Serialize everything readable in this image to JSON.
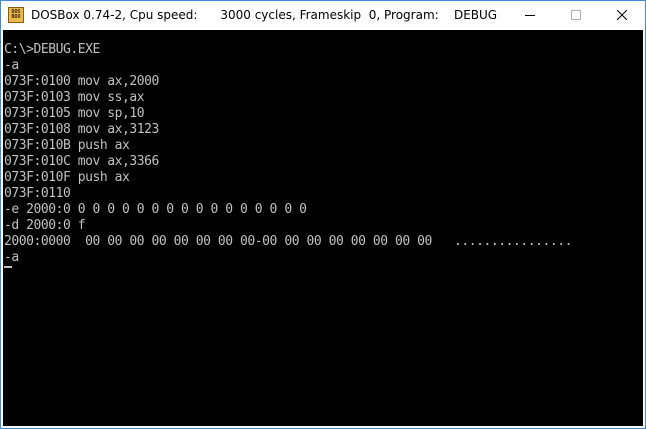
{
  "window": {
    "title": "DOSBox 0.74-2, Cpu speed:      3000 cycles, Frameskip  0, Program:    DEBUG",
    "icon": "dosbox-icon",
    "icon_text_top": "DOS",
    "icon_text_bottom": "BOX",
    "controls": [
      "minimize-icon",
      "maximize-icon",
      "close-icon"
    ]
  },
  "console": {
    "lines": [
      "C:\\>DEBUG.EXE",
      "-a",
      "073F:0100 mov ax,2000",
      "073F:0103 mov ss,ax",
      "073F:0105 mov sp,10",
      "073F:0108 mov ax,3123",
      "073F:010B push ax",
      "073F:010C mov ax,3366",
      "073F:010F push ax",
      "073F:0110",
      "-e 2000:0 0 0 0 0 0 0 0 0 0 0 0 0 0 0 0 0",
      "-d 2000:0 f",
      "2000:0000  00 00 00 00 00 00 00 00-00 00 00 00 00 00 00 00   ................",
      "-a"
    ],
    "text_color": "#c0c0c0",
    "background": "#000000"
  }
}
